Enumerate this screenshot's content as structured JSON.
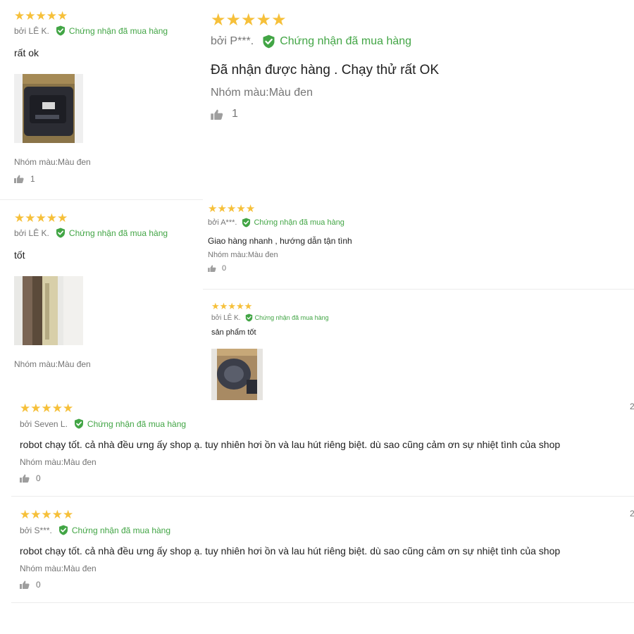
{
  "icons": {
    "star": "star-icon",
    "verified": "verified-check-icon",
    "like": "thumbs-up-icon"
  },
  "colors": {
    "star": "#f6c03a",
    "verified": "#42a545",
    "text": "#212121",
    "muted": "#757575"
  },
  "reviews": [
    {
      "rating": 5,
      "author": "bởi LÊ K.",
      "verified_label": "Chứng nhận đã mua hàng",
      "content": "rất ok",
      "variant": "Nhóm màu:Màu đen",
      "likes": "1"
    },
    {
      "rating": 5,
      "author": "bởi P***.",
      "verified_label": "Chứng nhận đã mua hàng",
      "content": "Đã nhận được hàng . Chạy thử rất OK",
      "variant": "Nhóm màu:Màu đen",
      "likes": "1"
    },
    {
      "rating": 5,
      "author": "bởi LÊ K.",
      "verified_label": "Chứng nhận đã mua hàng",
      "content": "tốt",
      "variant": "Nhóm màu:Màu đen"
    },
    {
      "rating": 5,
      "author": "bởi A***.",
      "verified_label": "Chứng nhận đã mua hàng",
      "content": "Giao hàng nhanh , hướng dẫn tận tình",
      "variant": "Nhóm màu:Màu đen",
      "likes": "0"
    },
    {
      "rating": 5,
      "author": "bởi LÊ K.",
      "verified_label": "Chứng nhận đã mua hàng",
      "content": "sản phẩm tốt"
    },
    {
      "rating": 5,
      "author": "bởi Seven L.",
      "verified_label": "Chứng nhận đã mua hàng",
      "content": "robot chạy tốt. cả nhà đều ưng ấy shop ạ. tuy nhiên hơi ồn và lau hút riêng biệt. dù sao cũng cảm ơn sự nhiệt tình của shop",
      "variant": "Nhóm màu:Màu đen",
      "likes": "0",
      "date_fragment": "2"
    },
    {
      "rating": 5,
      "author": "bởi S***.",
      "verified_label": "Chứng nhận đã mua hàng",
      "content": "robot chạy tốt. cả nhà đều ưng ấy shop ạ. tuy nhiên hơi ồn và lau hút riêng biệt. dù sao cũng cảm ơn sự nhiệt tình của shop",
      "variant": "Nhóm màu:Màu đen",
      "likes": "0",
      "date_fragment": "2"
    }
  ]
}
